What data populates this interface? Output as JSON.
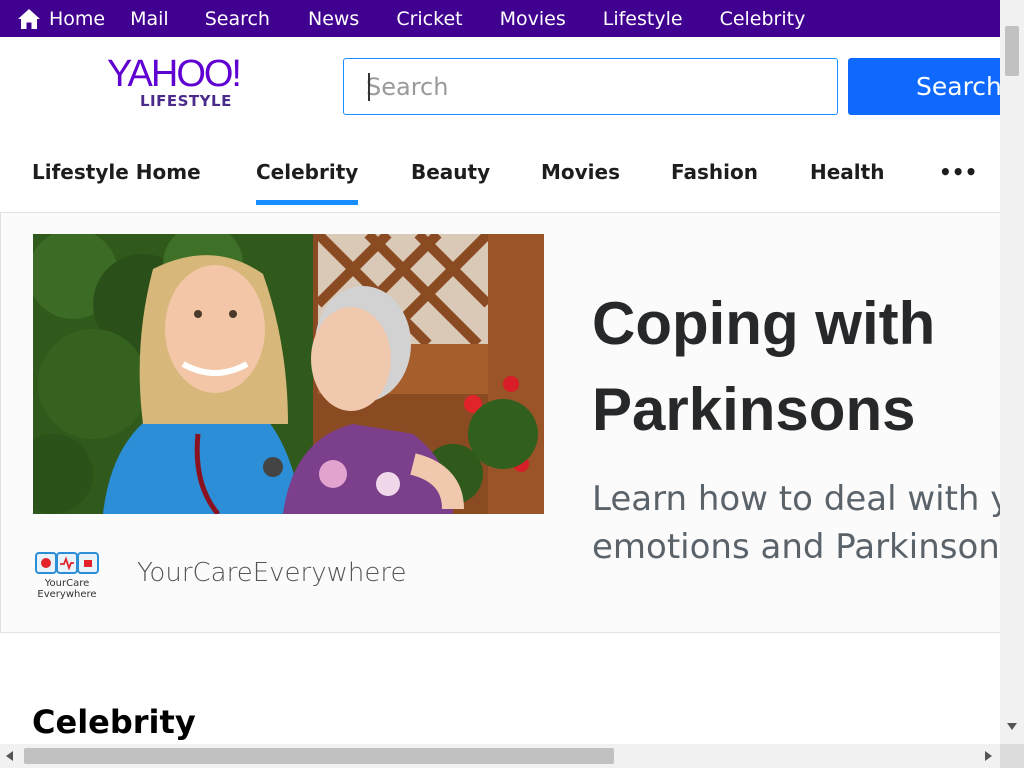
{
  "topnav": {
    "items": [
      "Home",
      "Mail",
      "Search",
      "News",
      "Cricket",
      "Movies",
      "Lifestyle",
      "Celebrity"
    ],
    "home_icon": "home-icon",
    "background": "#400090"
  },
  "header": {
    "logo_main": "YAHOO!",
    "logo_sub": "LIFESTYLE",
    "search_placeholder": "Search",
    "search_button": "Search",
    "accent": "#0f69ff"
  },
  "subnav": {
    "tabs": [
      "Lifestyle Home",
      "Celebrity",
      "Beauty",
      "Movies",
      "Fashion",
      "Health"
    ],
    "active_tab": "Celebrity",
    "more_label": "•••"
  },
  "ad": {
    "title": "Coping with Parkinsons",
    "description_line1": "Learn how to deal with your",
    "description_line2": "emotions and Parkinsons",
    "sponsor_name": "YourCareEverywhere",
    "sponsor_logo_line1": "YourCare",
    "sponsor_logo_line2": "Everywhere"
  },
  "section": {
    "title": "Celebrity"
  }
}
